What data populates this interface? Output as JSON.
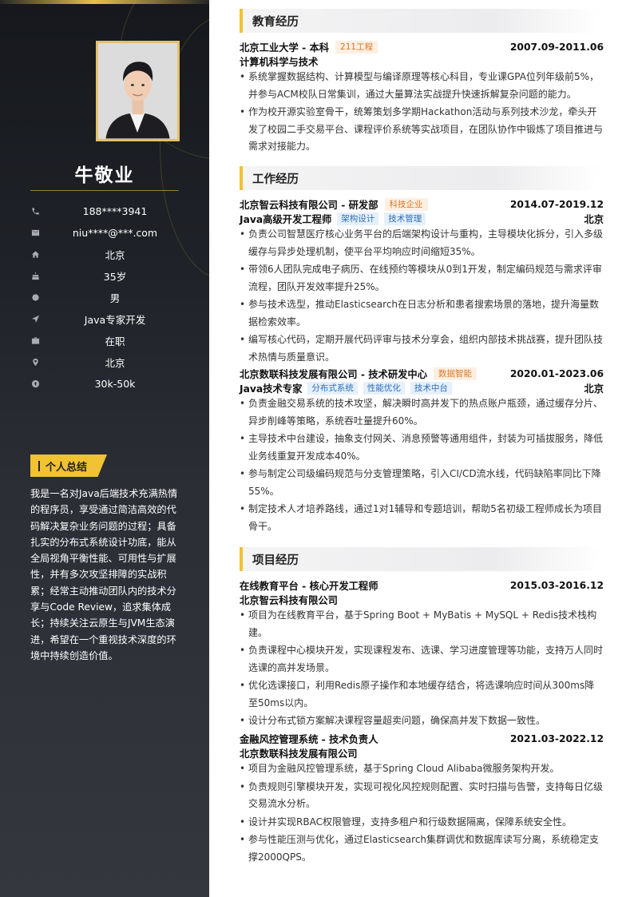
{
  "profile": {
    "name": "牛敬业",
    "info": [
      {
        "icon": "phone-icon",
        "value": "188****3941"
      },
      {
        "icon": "mail-icon",
        "value": "niu****@***.com"
      },
      {
        "icon": "home-icon",
        "value": "北京"
      },
      {
        "icon": "cake-icon",
        "value": "35岁"
      },
      {
        "icon": "gender-icon",
        "value": "男"
      },
      {
        "icon": "send-icon",
        "value": "Java专家开发"
      },
      {
        "icon": "briefcase-icon",
        "value": "在职"
      },
      {
        "icon": "location-icon",
        "value": "北京"
      },
      {
        "icon": "money-icon",
        "value": "30k-50k"
      }
    ]
  },
  "summary": {
    "title": "个人总结",
    "text": "我是一名对Java后端技术充满热情的程序员，享受通过简洁高效的代码解决复杂业务问题的过程；具备扎实的分布式系统设计功底，能从全局视角平衡性能、可用性与扩展性，并有多次攻坚排障的实战积累；经常主动推动团队内的技术分享与Code Review，追求集体成长；持续关注云原生与JVM生态演进，希望在一个重视技术深度的环境中持续创造价值。"
  },
  "education": {
    "title": "教育经历",
    "school": "北京工业大学 - 本科",
    "tag": "211工程",
    "period": "2007.09-2011.06",
    "major": "计算机科学与技术",
    "bullets": [
      "系统掌握数据结构、计算模型与编译原理等核心科目，专业课GPA位列年级前5%，并参与ACM校队日常集训，通过大量算法实战提升快速拆解复杂问题的能力。",
      "作为校开源实验室骨干，统筹策划多学期Hackathon活动与系列技术沙龙，牵头开发了校园二手交易平台、课程评价系统等实战项目，在团队协作中锻炼了项目推进与需求对接能力。"
    ]
  },
  "work": {
    "title": "工作经历",
    "jobs": [
      {
        "company": "北京智云科技有限公司 - 研发部",
        "tag": "科技企业",
        "period": "2014.07-2019.12",
        "position": "Java高级开发工程师",
        "skills": [
          "架构设计",
          "技术管理"
        ],
        "city": "北京",
        "bullets": [
          "负责公司智慧医疗核心业务平台的后端架构设计与重构，主导模块化拆分，引入多级缓存与异步处理机制，使平台平均响应时间缩短35%。",
          "带领6人团队完成电子病历、在线预约等模块从0到1开发，制定编码规范与需求评审流程，团队开发效率提升25%。",
          "参与技术选型，推动Elasticsearch在日志分析和患者搜索场景的落地，提升海量数据检索效率。",
          "编写核心代码，定期开展代码评审与技术分享会，组织内部技术挑战赛，提升团队技术热情与质量意识。"
        ]
      },
      {
        "company": "北京数联科技发展有限公司 - 技术研发中心",
        "tag": "数据智能",
        "period": "2020.01-2023.06",
        "position": "Java技术专家",
        "skills": [
          "分布式系统",
          "性能优化",
          "技术中台"
        ],
        "city": "北京",
        "bullets": [
          "负责金融交易系统的技术攻坚，解决瞬时高并发下的热点账户瓶颈，通过缓存分片、异步削峰等策略，系统吞吐量提升60%。",
          "主导技术中台建设，抽象支付网关、消息预警等通用组件，封装为可插拔服务，降低业务线重复开发成本40%。",
          "参与制定公司级编码规范与分支管理策略，引入CI/CD流水线，代码缺陷率同比下降55%。",
          "制定技术人才培养路线，通过1对1辅导和专题培训，帮助5名初级工程师成长为项目骨干。"
        ]
      }
    ]
  },
  "projects": {
    "title": "项目经历",
    "items": [
      {
        "name": "在线教育平台 - 核心开发工程师",
        "period": "2015.03-2016.12",
        "company": "北京智云科技有限公司",
        "bullets": [
          "项目为在线教育平台，基于Spring Boot + MyBatis + MySQL + Redis技术栈构建。",
          "负责课程中心模块开发，实现课程发布、选课、学习进度管理等功能，支持万人同时选课的高并发场景。",
          "优化选课接口，利用Redis原子操作和本地缓存结合，将选课响应时间从300ms降至50ms以内。",
          "设计分布式锁方案解决课程容量超卖问题，确保高并发下数据一致性。"
        ]
      },
      {
        "name": "金融风控管理系统 - 技术负责人",
        "period": "2021.03-2022.12",
        "company": "北京数联科技发展有限公司",
        "bullets": [
          "项目为金融风控管理系统，基于Spring Cloud Alibaba微服务架构开发。",
          "负责规则引擎模块开发，实现可视化风控规则配置、实时扫描与告警，支持每日亿级交易流水分析。",
          "设计并实现RBAC权限管理，支持多租户和行级数据隔离，保障系统安全性。",
          "参与性能压测与优化，通过Elasticsearch集群调优和数据库读写分离，系统稳定支撑2000QPS。"
        ]
      }
    ]
  },
  "colors": {
    "accent": "#f1c232",
    "sidebar_dark": "#16181d",
    "tag_orange": "#d9772a",
    "tag_blue": "#2f6fb6"
  }
}
